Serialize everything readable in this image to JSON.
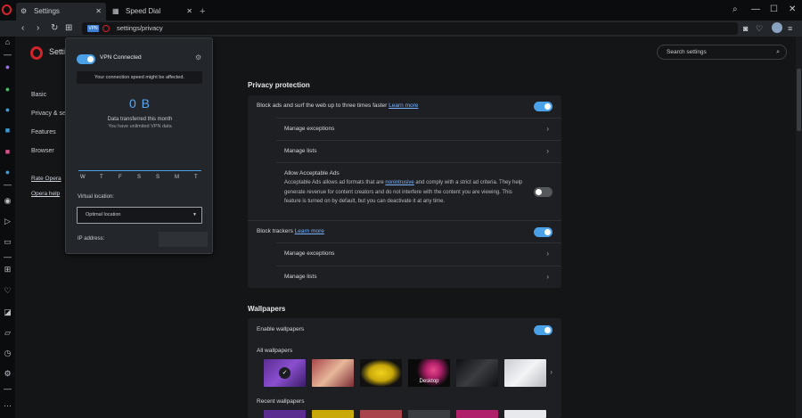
{
  "tabs": [
    {
      "label": "Settings",
      "icon": "gear-icon",
      "close": "✕"
    },
    {
      "label": "Speed Dial",
      "icon": "grid-icon",
      "close": "✕"
    }
  ],
  "new_tab_label": "+",
  "window": {
    "minimize": "—",
    "maximize": "☐",
    "close": "✕"
  },
  "address": {
    "url": "settings/privacy",
    "vpn_badge": "VPN"
  },
  "settings_nav": {
    "title": "Setti",
    "items": [
      "Basic",
      "Privacy & se",
      "Features",
      "Browser"
    ],
    "links": [
      "Rate Opera",
      "Opera help"
    ]
  },
  "search": {
    "placeholder": "Search settings"
  },
  "privacy": {
    "section_title": "Privacy protection",
    "block_ads": "Block ads and surf the web up to three times faster",
    "learn_more": "Learn more",
    "manage_exceptions": "Manage exceptions",
    "manage_lists": "Manage lists",
    "acceptable_ads_title": "Allow Acceptable Ads",
    "acceptable_ads_desc_1": "Acceptable Ads allows ad formats that are ",
    "acceptable_ads_link": "nonintrusive",
    "acceptable_ads_desc_2": " and comply with a strict ad criteria. They help generate revenue for content creators and do not interfere with the content you are viewing. This feature is turned on by default, but you can deactivate it at any time.",
    "block_trackers": "Block trackers",
    "block_ads_on": true,
    "acceptable_ads_on": false,
    "block_trackers_on": true
  },
  "wallpapers": {
    "section_title": "Wallpapers",
    "enable": "Enable wallpapers",
    "enable_on": true,
    "all": "All wallpapers",
    "recent": "Recent wallpapers",
    "desktop_label": "Desktop",
    "check": "✓"
  },
  "vpn": {
    "status": "VPN Connected",
    "warning": "Your connection speed might be affected.",
    "bytes": "0 B",
    "transferred": "Data transferred this month",
    "unlimited": "You have unlimited VPN data",
    "days": [
      "W",
      "T",
      "F",
      "S",
      "S",
      "M",
      "T"
    ],
    "location_label": "Virtual location:",
    "location_value": "Optimal location",
    "ip_label": "IP address:"
  },
  "colors": {
    "accent": "#4aa1e8",
    "opera_red": "#d4242b"
  }
}
